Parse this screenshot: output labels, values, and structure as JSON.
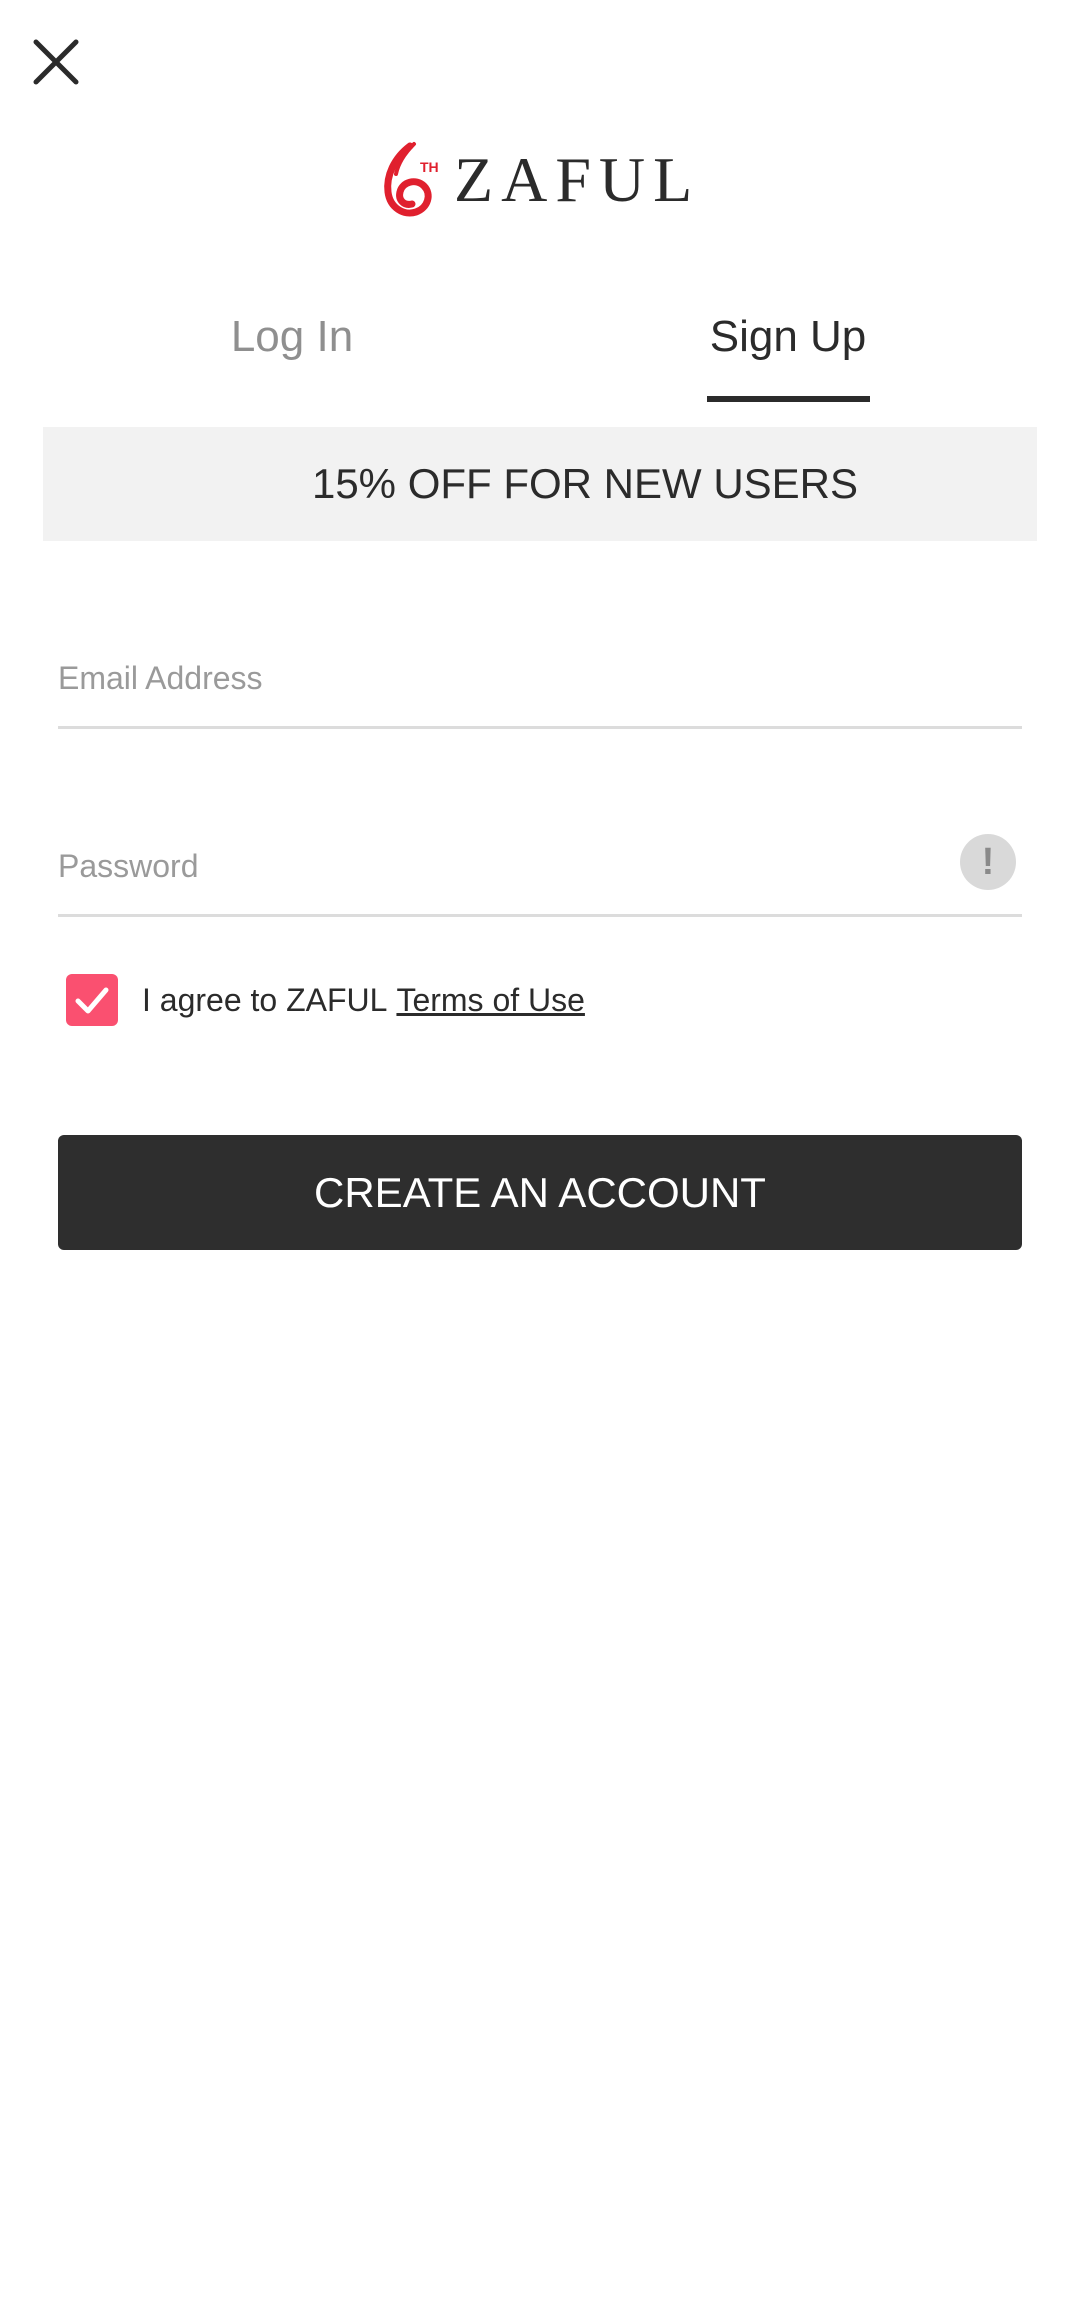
{
  "header": {
    "close_icon": "close-icon",
    "brand": {
      "name": "ZAFUL",
      "badge": "TH",
      "badge_number": "6",
      "brand_color": "#e0202e"
    }
  },
  "tabs": [
    {
      "label": "Log In",
      "active": false
    },
    {
      "label": "Sign Up",
      "active": true
    }
  ],
  "promo": {
    "text": "15% OFF FOR NEW USERS"
  },
  "form": {
    "email": {
      "placeholder": "Email Address",
      "value": ""
    },
    "password": {
      "placeholder": "Password",
      "value": "",
      "info_icon": "!"
    },
    "agree": {
      "checked": true,
      "text": "I agree to ZAFUL",
      "link": "Terms of Use",
      "checkbox_color": "#fa5070"
    },
    "submit_label": "CREATE AN ACCOUNT"
  }
}
